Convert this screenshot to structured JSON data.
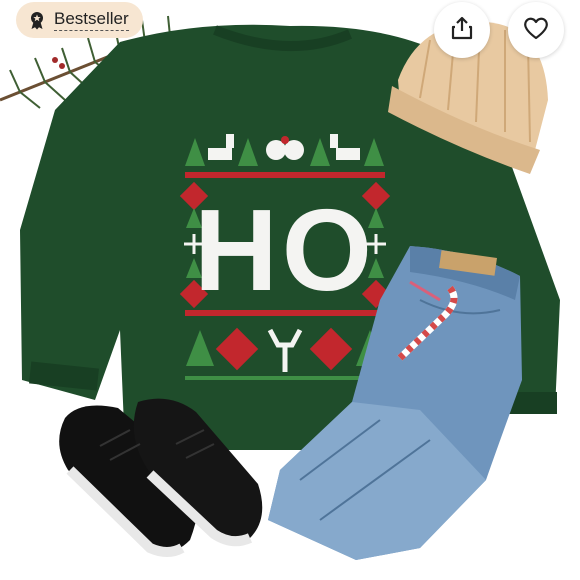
{
  "badge": {
    "label": "Bestseller",
    "icon": "award-ribbon-icon"
  },
  "actions": {
    "share_icon": "share-icon",
    "favorite_icon": "heart-icon"
  },
  "product": {
    "sweater_text": "HO",
    "colors": {
      "sweater": "#1f4d2b",
      "knit_white": "#f4f4f2",
      "knit_red": "#c2272d",
      "knit_green": "#3f8f45",
      "badge_bg": "#f7e6d2"
    }
  }
}
